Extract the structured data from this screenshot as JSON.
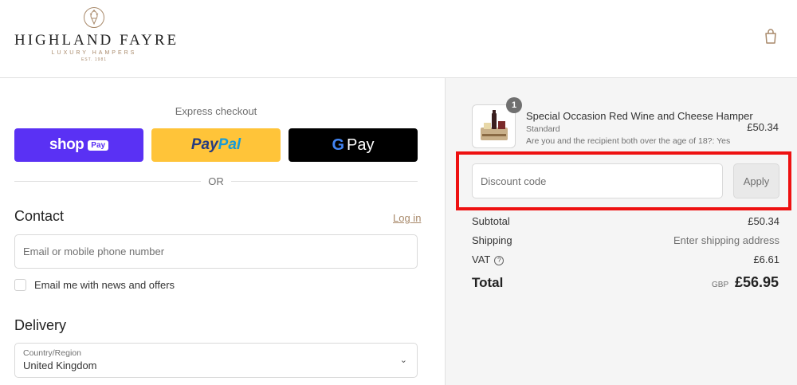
{
  "header": {
    "brand": "HIGHLAND FAYRE",
    "tagline": "LUXURY HAMPERS",
    "est": "EST. 1981",
    "logo_icon": "thistle-icon",
    "cart_icon": "shopping-bag-icon"
  },
  "express": {
    "label": "Express checkout",
    "shop_pay": {
      "text": "shop",
      "pill": "Pay"
    },
    "paypal": {
      "part1": "Pay",
      "part2": "Pal"
    },
    "gpay": {
      "g": "G",
      "text": "Pay"
    },
    "or": "OR"
  },
  "contact": {
    "heading": "Contact",
    "login": "Log in",
    "email_placeholder": "Email or mobile phone number",
    "newsletter_label": "Email me with news and offers"
  },
  "delivery": {
    "heading": "Delivery",
    "country_label": "Country/Region",
    "country_value": "United Kingdom"
  },
  "order": {
    "item": {
      "quantity": "1",
      "name": "Special Occasion Red Wine and Cheese Hamper",
      "variant": "Standard",
      "question": "Are you and the recipient both over the age of 18?: Yes",
      "price": "£50.34"
    },
    "discount_placeholder": "Discount code",
    "apply_label": "Apply",
    "subtotal_label": "Subtotal",
    "subtotal_value": "£50.34",
    "shipping_label": "Shipping",
    "shipping_value": "Enter shipping address",
    "vat_label": "VAT",
    "vat_value": "£6.61",
    "total_label": "Total",
    "currency": "GBP",
    "total_value": "£56.95"
  },
  "colors": {
    "accent": "#a8896a",
    "shop_pay": "#5a31f4",
    "paypal": "#ffc439",
    "highlight": "#ee1111"
  }
}
